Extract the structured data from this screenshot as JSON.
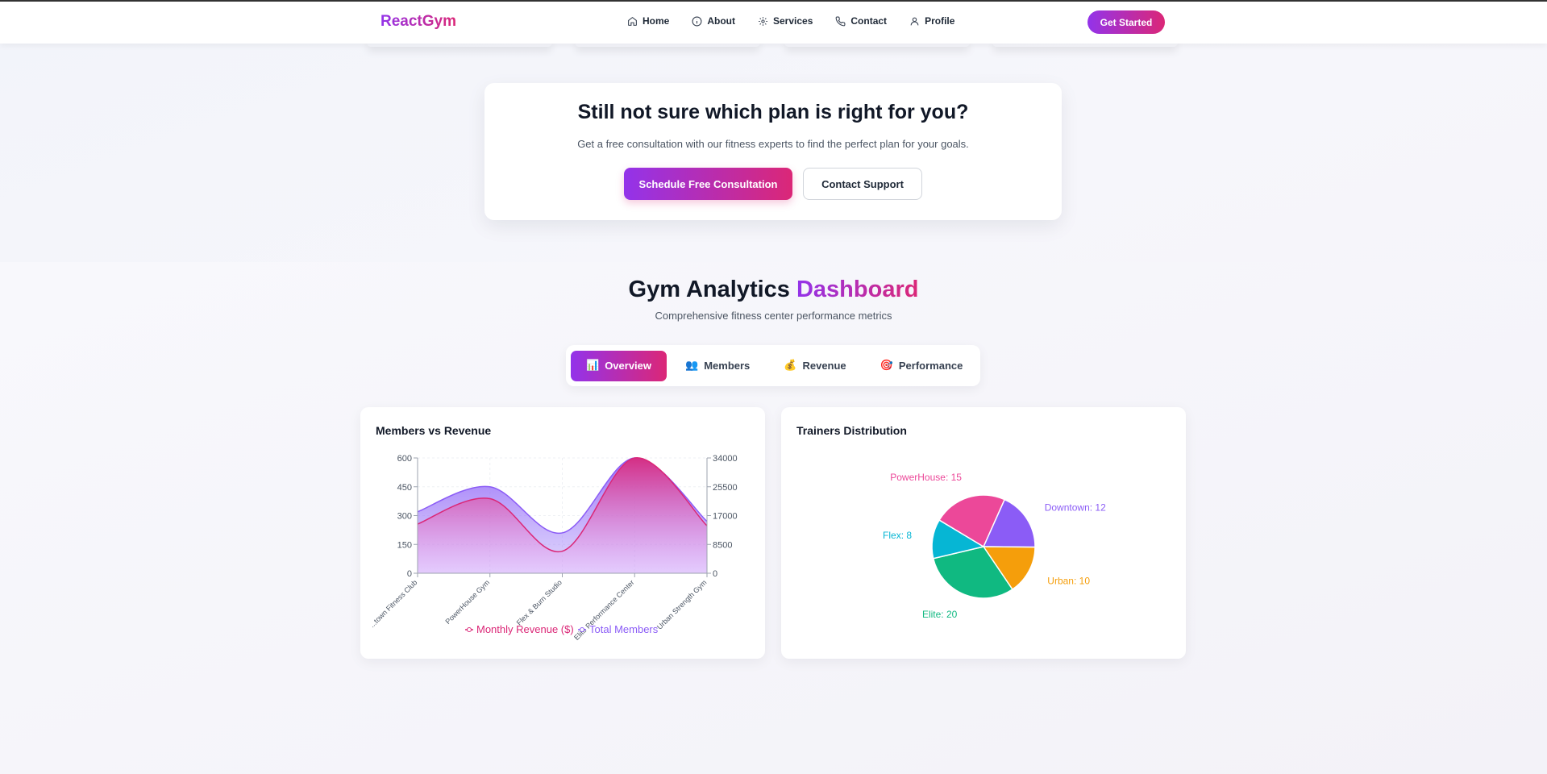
{
  "nav": {
    "brand": "ReactGym",
    "links": [
      {
        "label": "Home",
        "icon": "home-icon"
      },
      {
        "label": "About",
        "icon": "info-icon"
      },
      {
        "label": "Services",
        "icon": "gear-icon"
      },
      {
        "label": "Contact",
        "icon": "phone-icon"
      },
      {
        "label": "Profile",
        "icon": "user-icon"
      }
    ],
    "cta": "Get Started"
  },
  "cta": {
    "title": "Still not sure which plan is right for you?",
    "subtitle": "Get a free consultation with our fitness experts to find the perfect plan for your goals.",
    "primary": "Schedule Free Consultation",
    "secondary": "Contact Support"
  },
  "dashboard": {
    "title_main": "Gym Analytics",
    "title_accent": "Dashboard",
    "subtitle": "Comprehensive fitness center performance metrics",
    "tabs": [
      {
        "label": "Overview",
        "icon": "📊",
        "active": true
      },
      {
        "label": "Members",
        "icon": "👥",
        "active": false
      },
      {
        "label": "Revenue",
        "icon": "💰",
        "active": false
      },
      {
        "label": "Performance",
        "icon": "🎯",
        "active": false
      }
    ]
  },
  "colors": {
    "accent_purple": "#9333ea",
    "accent_pink": "#db2777",
    "revenue": "#db2777",
    "members": "#8b5cf6"
  },
  "chart_data": [
    {
      "type": "area",
      "title": "Members vs Revenue",
      "categories": [
        "Downtown Fitness Club",
        "PowerHouse Gym",
        "Flex & Burn Studio",
        "Elite Performance Center",
        "Urban Strength Gym"
      ],
      "category_labels_visible": [
        "...town Fitness Club",
        "PowerHouse Gym",
        "Flex & Burn Studio",
        "Elite Performance Center",
        "Urban Strength Gym"
      ],
      "y_left": {
        "ticks": [
          "0",
          "150",
          "300",
          "450",
          "600"
        ],
        "lim": [
          0,
          600
        ]
      },
      "y_right": {
        "ticks": [
          "0",
          "8500",
          "17000",
          "25500",
          "34000"
        ],
        "lim": [
          0,
          34000
        ]
      },
      "series": [
        {
          "name": "Monthly Revenue ($)",
          "axis": "right",
          "color": "#db2777",
          "values": [
            14500,
            22000,
            6500,
            34000,
            14000
          ]
        },
        {
          "name": "Total Members",
          "axis": "left",
          "color": "#8b5cf6",
          "values": [
            320,
            450,
            210,
            600,
            270
          ]
        }
      ],
      "legend": "bottom",
      "grid": true
    },
    {
      "type": "pie",
      "title": "Trainers Distribution",
      "slices": [
        {
          "name": "Downtown",
          "value": 12,
          "label": "Downtown: 12",
          "color": "#8b5cf6"
        },
        {
          "name": "Urban",
          "value": 10,
          "label": "Urban: 10",
          "color": "#f59e0b"
        },
        {
          "name": "Elite",
          "value": 20,
          "label": "Elite: 20",
          "color": "#10b981"
        },
        {
          "name": "Flex",
          "value": 8,
          "label": "Flex: 8",
          "color": "#06b6d4"
        },
        {
          "name": "PowerHouse",
          "value": 15,
          "label": "PowerHouse: 15",
          "color": "#ec4899"
        }
      ]
    }
  ]
}
